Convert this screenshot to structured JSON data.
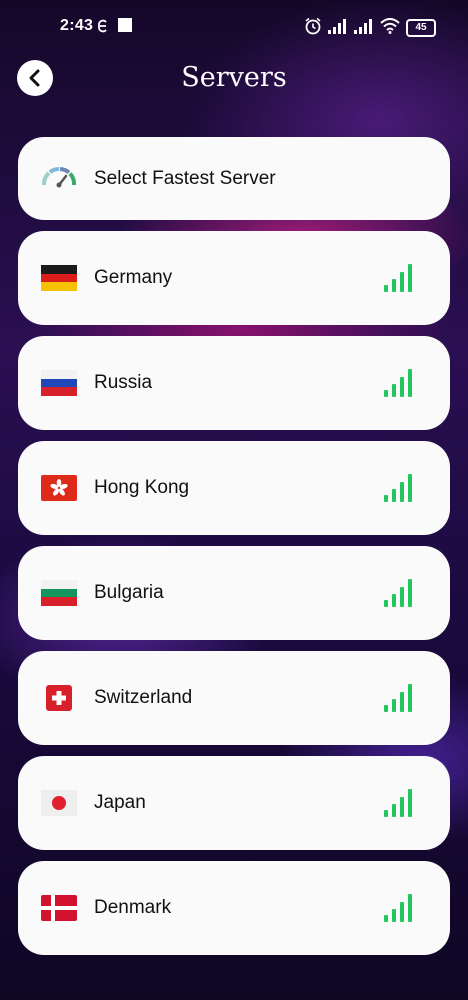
{
  "status_bar": {
    "time": "2:43",
    "battery": "45"
  },
  "header": {
    "title": "Servers"
  },
  "fastest": {
    "label": "Select Fastest Server"
  },
  "servers": [
    {
      "name": "Germany",
      "flag": "germany-flag"
    },
    {
      "name": "Russia",
      "flag": "russia-flag"
    },
    {
      "name": "Hong Kong",
      "flag": "hong-kong-flag"
    },
    {
      "name": "Bulgaria",
      "flag": "bulgaria-flag"
    },
    {
      "name": "Switzerland",
      "flag": "switzerland-flag"
    },
    {
      "name": "Japan",
      "flag": "japan-flag"
    },
    {
      "name": "Denmark",
      "flag": "denmark-flag"
    }
  ],
  "colors": {
    "signal": "#22c55e",
    "card": "#fafafa",
    "background": "#1a0b3a"
  }
}
